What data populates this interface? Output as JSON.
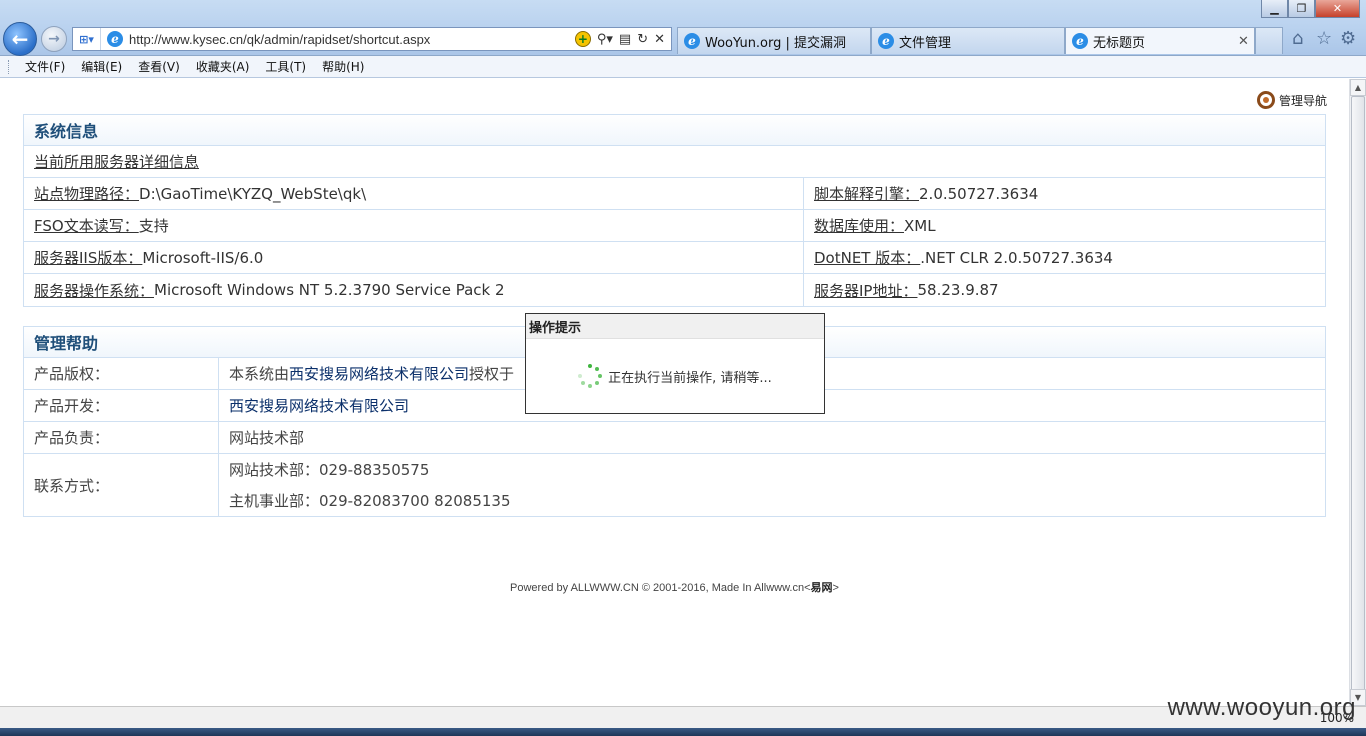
{
  "browser": {
    "url": "http://www.kysec.cn/qk/admin/rapidset/shortcut.aspx",
    "tabs": [
      {
        "label": "WooYun.org | 提交漏洞"
      },
      {
        "label": "文件管理"
      },
      {
        "label": "无标题页"
      }
    ],
    "menu": [
      "文件(F)",
      "编辑(E)",
      "查看(V)",
      "收藏夹(A)",
      "工具(T)",
      "帮助(H)"
    ],
    "zoom": "100%"
  },
  "page": {
    "nav_link": "管理导航",
    "sysinfo": {
      "title": "系统信息",
      "subtitle": "当前所用服务器详细信息",
      "rows": [
        {
          "left_label": "站点物理路径：",
          "left_value": "D:\\GaoTime\\KYZQ_WebSte\\qk\\",
          "right_label": "脚本解释引擎：",
          "right_value": "2.0.50727.3634"
        },
        {
          "left_label": "FSO文本读写：",
          "left_value": "支持",
          "right_label": "数据库使用：",
          "right_value": "XML"
        },
        {
          "left_label": "服务器IIS版本：",
          "left_value": "Microsoft-IIS/6.0",
          "right_label": "DotNET 版本：",
          "right_value": ".NET CLR 2.0.50727.3634"
        },
        {
          "left_label": "服务器操作系统：",
          "left_value": "Microsoft Windows NT 5.2.3790 Service Pack 2",
          "right_label": "服务器IP地址：",
          "right_value": "58.23.9.87"
        }
      ]
    },
    "help": {
      "title": "管理帮助",
      "copyright_key": "产品版权：",
      "copyright_prefix": "本系统由",
      "copyright_company": "西安搜易网络技术有限公司",
      "copyright_suffix": "授权于",
      "dev_key": "产品开发：",
      "dev_value": "西安搜易网络技术有限公司",
      "owner_key": "产品负责：",
      "owner_value": "网站技术部",
      "contact_key": "联系方式：",
      "contact_line1": "网站技术部：029-88350575",
      "contact_line2": "主机事业部：029-82083700 82085135"
    },
    "footer": {
      "powered": "Powered by",
      "brand": "ALLWWW.CN",
      "copy": "© 2001-2016, Made In Allwww.cn<",
      "brand2": "易网",
      "end": ">"
    }
  },
  "modal": {
    "title": "操作提示",
    "message": "正在执行当前操作, 请稍等..."
  },
  "watermark": "www.wooyun.org",
  "colors": {
    "accent": "#1f4f7a",
    "border": "#cfe0f2",
    "spinner": "#3fb53f"
  }
}
